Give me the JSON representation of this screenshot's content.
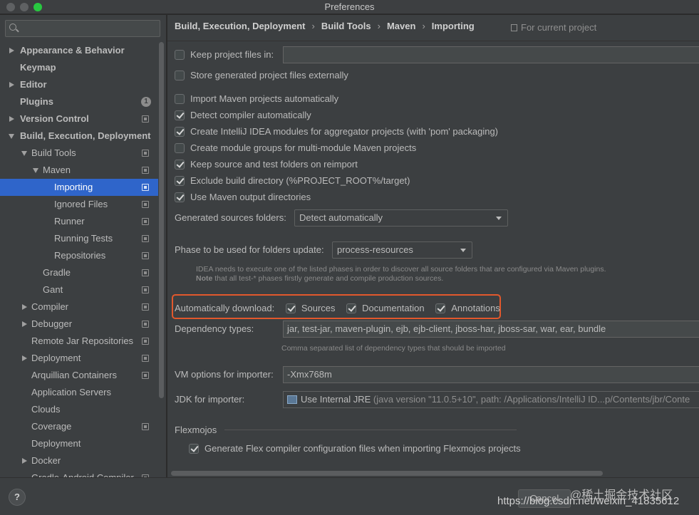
{
  "window": {
    "title": "Preferences"
  },
  "sidebar": {
    "search_placeholder": "",
    "items": [
      {
        "label": "Appearance & Behavior",
        "bold": true,
        "indent": 0,
        "arrow": "right"
      },
      {
        "label": "Keymap",
        "bold": true,
        "indent": 0,
        "arrow": ""
      },
      {
        "label": "Editor",
        "bold": true,
        "indent": 0,
        "arrow": "right"
      },
      {
        "label": "Plugins",
        "bold": true,
        "indent": 0,
        "arrow": "",
        "badge": "1"
      },
      {
        "label": "Version Control",
        "bold": true,
        "indent": 0,
        "arrow": "right",
        "copy": true
      },
      {
        "label": "Build, Execution, Deployment",
        "bold": true,
        "indent": 0,
        "arrow": "down"
      },
      {
        "label": "Build Tools",
        "bold": false,
        "indent": 1,
        "arrow": "down",
        "copy": true
      },
      {
        "label": "Maven",
        "bold": false,
        "indent": 2,
        "arrow": "down",
        "copy": true
      },
      {
        "label": "Importing",
        "bold": false,
        "indent": 3,
        "arrow": "",
        "copy": true,
        "selected": true
      },
      {
        "label": "Ignored Files",
        "bold": false,
        "indent": 3,
        "arrow": "",
        "copy": true
      },
      {
        "label": "Runner",
        "bold": false,
        "indent": 3,
        "arrow": "",
        "copy": true
      },
      {
        "label": "Running Tests",
        "bold": false,
        "indent": 3,
        "arrow": "",
        "copy": true
      },
      {
        "label": "Repositories",
        "bold": false,
        "indent": 3,
        "arrow": "",
        "copy": true
      },
      {
        "label": "Gradle",
        "bold": false,
        "indent": 2,
        "arrow": "",
        "copy": true
      },
      {
        "label": "Gant",
        "bold": false,
        "indent": 2,
        "arrow": "",
        "copy": true
      },
      {
        "label": "Compiler",
        "bold": false,
        "indent": 1,
        "arrow": "right",
        "copy": true
      },
      {
        "label": "Debugger",
        "bold": false,
        "indent": 1,
        "arrow": "right",
        "copy": true
      },
      {
        "label": "Remote Jar Repositories",
        "bold": false,
        "indent": 1,
        "arrow": "",
        "copy": true
      },
      {
        "label": "Deployment",
        "bold": false,
        "indent": 1,
        "arrow": "right",
        "copy": true
      },
      {
        "label": "Arquillian Containers",
        "bold": false,
        "indent": 1,
        "arrow": "",
        "copy": true
      },
      {
        "label": "Application Servers",
        "bold": false,
        "indent": 1,
        "arrow": ""
      },
      {
        "label": "Clouds",
        "bold": false,
        "indent": 1,
        "arrow": ""
      },
      {
        "label": "Coverage",
        "bold": false,
        "indent": 1,
        "arrow": "",
        "copy": true
      },
      {
        "label": "Deployment",
        "bold": false,
        "indent": 1,
        "arrow": ""
      },
      {
        "label": "Docker",
        "bold": false,
        "indent": 1,
        "arrow": "right"
      },
      {
        "label": "Gradle-Android Compiler",
        "bold": false,
        "indent": 1,
        "arrow": "",
        "copy": true
      }
    ],
    "help_label": "?"
  },
  "breadcrumb": {
    "items": [
      "Build, Execution, Deployment",
      "Build Tools",
      "Maven",
      "Importing"
    ],
    "separator": "›",
    "scope_label": "For current project"
  },
  "settings": {
    "keep_project_files": {
      "label": "Keep project files in:",
      "checked": false,
      "value": ""
    },
    "store_externally": {
      "label": "Store generated project files externally",
      "checked": false
    },
    "import_auto": {
      "label": "Import Maven projects automatically",
      "checked": false
    },
    "detect_compiler": {
      "label": "Detect compiler automatically",
      "checked": true
    },
    "create_modules": {
      "label": "Create IntelliJ IDEA modules for aggregator projects (with 'pom' packaging)",
      "checked": true
    },
    "module_groups": {
      "label": "Create module groups for multi-module Maven projects",
      "checked": false
    },
    "keep_source": {
      "label": "Keep source and test folders on reimport",
      "checked": true
    },
    "exclude_build": {
      "label": "Exclude build directory (%PROJECT_ROOT%/target)",
      "checked": true
    },
    "use_output": {
      "label": "Use Maven output directories",
      "checked": true
    },
    "generated_sources": {
      "label": "Generated sources folders:",
      "value": "Detect automatically"
    },
    "phase": {
      "label": "Phase to be used for folders update:",
      "value": "process-resources",
      "hint1": "IDEA needs to execute one of the listed phases in order to discover all source folders that are configured via Maven plugins.",
      "hint2_bold": "Note",
      "hint2": " that all test-* phases firstly generate and compile production sources."
    },
    "auto_download": {
      "label": "Automatically download:",
      "sources": {
        "label": "Sources",
        "checked": true
      },
      "documentation": {
        "label": "Documentation",
        "checked": true
      },
      "annotations": {
        "label": "Annotations",
        "checked": true
      }
    },
    "dependency_types": {
      "label": "Dependency types:",
      "value": "jar, test-jar, maven-plugin, ejb, ejb-client, jboss-har, jboss-sar, war, ear, bundle",
      "hint": "Comma separated list of dependency types that should be imported"
    },
    "vm_options": {
      "label": "VM options for importer:",
      "value": "-Xmx768m"
    },
    "jdk": {
      "label": "JDK for importer:",
      "value": "Use Internal JRE",
      "detail": " (java version \"11.0.5+10\", path: /Applications/IntelliJ ID...p/Contents/jbr/Conte"
    },
    "flexmojos": {
      "section": "Flexmojos",
      "generate": {
        "label": "Generate Flex compiler configuration files when importing Flexmojos projects",
        "checked": true
      }
    }
  },
  "footer": {
    "cancel_label": "Cancel",
    "watermark": "@稀土掘金技术社区",
    "url": "https://blog.csdn.net/weixin_41835612"
  },
  "colors": {
    "background": "#3c3f41",
    "selection": "#2f65ca",
    "highlight_border": "#e2582c"
  }
}
